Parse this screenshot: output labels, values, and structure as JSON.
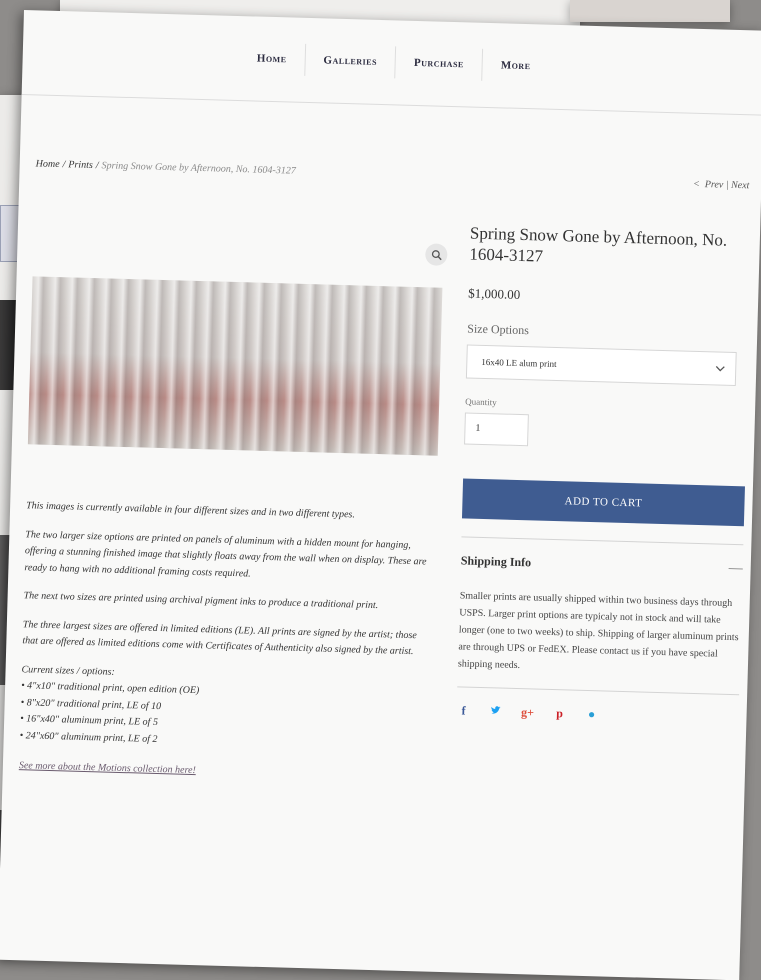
{
  "nav": {
    "items": [
      "Home",
      "Galleries",
      "Purchase",
      "More"
    ]
  },
  "breadcrumb": {
    "home": "Home",
    "category": "Prints",
    "separator": "/",
    "current": "Spring Snow Gone by Afternoon, No. 1604-3127"
  },
  "pager": {
    "prev": "Prev",
    "separator": "|",
    "next": "Next"
  },
  "icons": {
    "zoom": "search-icon",
    "dropdown": "chevron-down-icon",
    "collapse": "minus-icon"
  },
  "product": {
    "title": "Spring Snow Gone by Afternoon, No. 1604-3127",
    "price": "$1,000.00",
    "size_label": "Size Options",
    "size_selected": "16x40 LE alum print",
    "quantity_label": "Quantity",
    "quantity_value": "1",
    "add_to_cart": "ADD TO CART"
  },
  "description": {
    "paragraphs": [
      "This images is currently available in four different sizes and in two different types.",
      "The two larger size options are printed on panels of aluminum with a hidden mount for hanging, offering a stunning finished image that slightly floats away from the wall when on display. These are ready to hang with no additional framing costs required.",
      "The next two sizes are printed using archival pigment inks to produce a traditional print.",
      "The three largest sizes are offered in limited editions (LE). All prints are signed by the artist; those that are offered as limited editions come with Certificates of Authenticity also signed by the artist."
    ],
    "sizes_title": "Current sizes / options:",
    "sizes": [
      "• 4\"x10\" traditional print, open edition (OE)",
      "• 8\"x20\" traditional print, LE of 10",
      "• 16\"x40\" aluminum print, LE of 5",
      "• 24\"x60\" aluminum print, LE of 2"
    ],
    "more_link": "See more about the Motions collection here!"
  },
  "shipping": {
    "title": "Shipping Info",
    "toggle": "—",
    "text": "Smaller prints are usually shipped within two business days through USPS. Larger print options are typicaly not in stock and will take longer (one to two weeks) to ship. Shipping of larger aluminum prints are through UPS or FedEX. Please contact us if you have special shipping needs."
  },
  "social": [
    {
      "icon": "facebook-icon",
      "glyph": "f",
      "color": "#3b5998"
    },
    {
      "icon": "twitter-icon",
      "glyph": "🐦",
      "color": "#1da1f2"
    },
    {
      "icon": "google-plus-icon",
      "glyph": "g+",
      "color": "#dd4b39"
    },
    {
      "icon": "pinterest-icon",
      "glyph": "p",
      "color": "#cb2027"
    },
    {
      "icon": "tumblr-icon",
      "glyph": "●",
      "color": "#2a9fd6"
    }
  ]
}
